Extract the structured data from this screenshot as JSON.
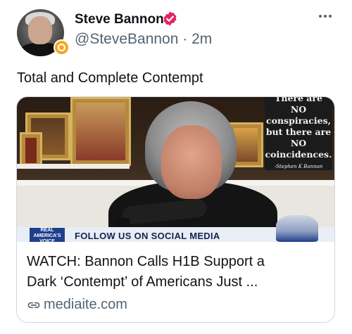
{
  "author": {
    "name": "Steve Bannon",
    "handle": "@SteveBannon",
    "separator": "·",
    "time_ago": "2m"
  },
  "tweet": {
    "text": "Total and Complete Contempt"
  },
  "card": {
    "image_sign": {
      "line0": "There are",
      "line1": "NO",
      "line2": "conspiracies,",
      "line3": "but there are",
      "line4": "NO",
      "line5": "coincidences.",
      "signature": "-Stephen K Bannon"
    },
    "image_logo": "REAL AMERICA'S VOICE",
    "image_banner": "FOLLOW US ON SOCIAL MEDIA",
    "title_line1": "WATCH: Bannon Calls H1B Support a",
    "title_line2": "Dark ‘Contempt’ of Americans Just ...",
    "domain": "mediaite.com"
  },
  "colors": {
    "verified_badge": "#e0245e",
    "secondary_text": "#536471",
    "card_border": "#cfd9de"
  },
  "icons": {
    "verified": "verified-badge-icon",
    "more": "more-options-icon",
    "link": "link-icon"
  }
}
